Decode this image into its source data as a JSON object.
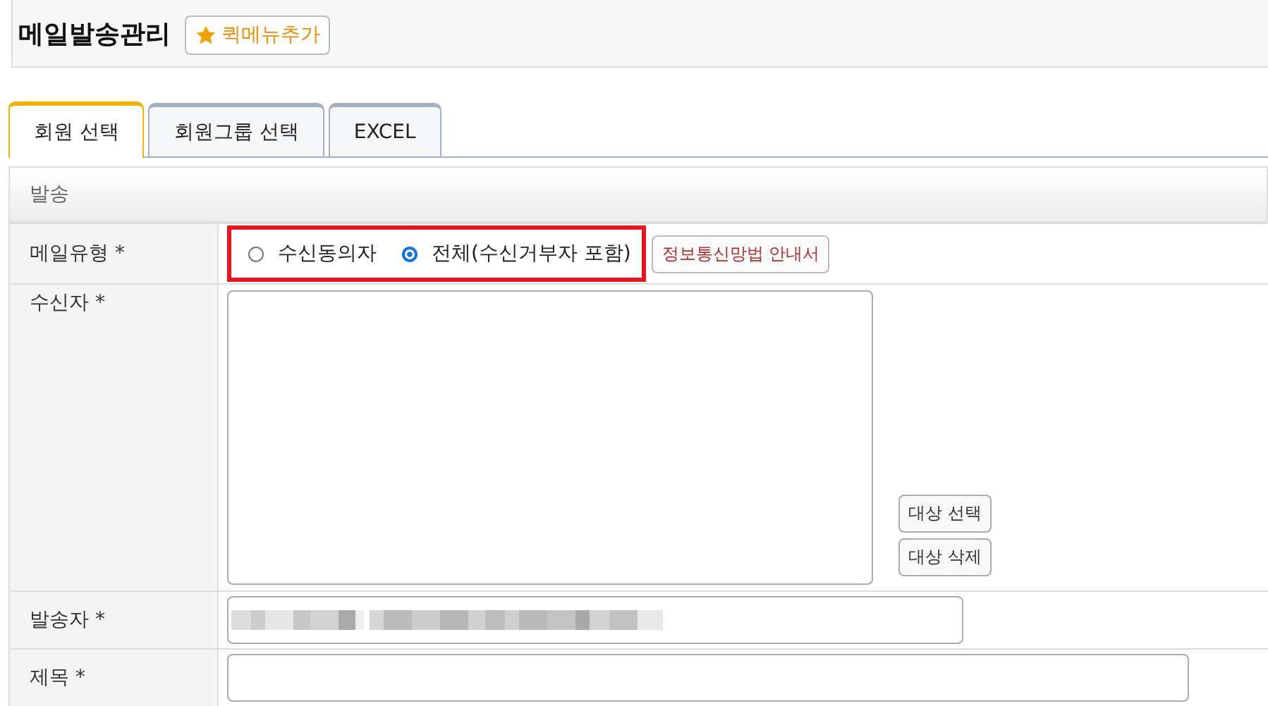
{
  "header": {
    "title": "메일발송관리",
    "quick_menu_button": "퀵메뉴추가"
  },
  "tabs": [
    {
      "label": "회원 선택",
      "selected": true
    },
    {
      "label": "회원그룹 선택",
      "selected": false
    },
    {
      "label": "EXCEL",
      "selected": false
    }
  ],
  "section": {
    "title": "발송"
  },
  "form": {
    "mail_type": {
      "label": "메일유형 *",
      "options": [
        {
          "label": "수신동의자",
          "selected": false
        },
        {
          "label": "전체(수신거부자 포함)",
          "selected": true
        }
      ],
      "highlighted": true,
      "guide_button": "정보통신망법 안내서"
    },
    "recipients": {
      "label": "수신자 *",
      "buttons": [
        "대상 선택",
        "대상 삭제"
      ]
    },
    "sender": {
      "label": "발송자 *",
      "redacted": true
    },
    "subject": {
      "label": "제목 *"
    }
  }
}
